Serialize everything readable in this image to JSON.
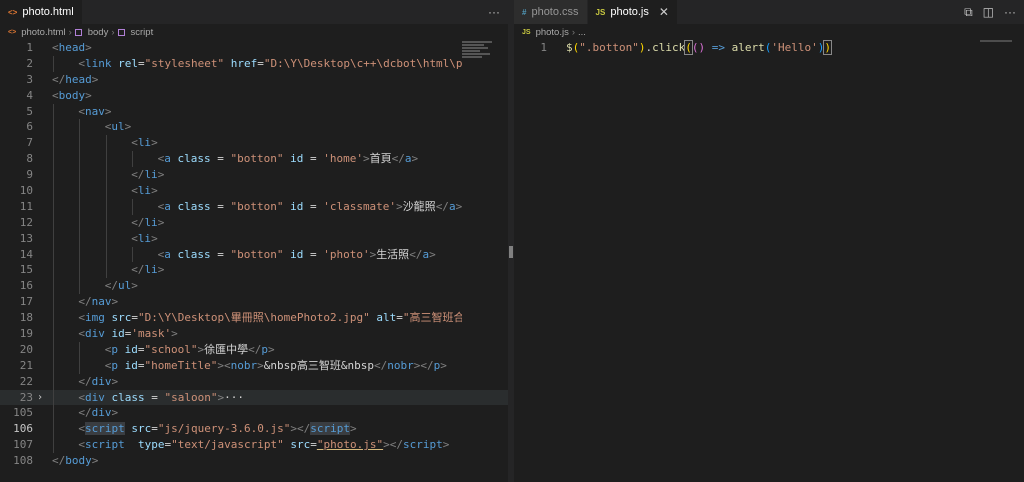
{
  "left": {
    "tab": {
      "label": "photo.html",
      "icon": "html-icon",
      "more": "···"
    },
    "breadcrumb": [
      "photo.html",
      "body",
      "script"
    ],
    "lines": [
      {
        "n": "1",
        "indent": 0,
        "tokens": [
          [
            "br",
            "<"
          ],
          [
            "tag",
            "head"
          ],
          [
            "br",
            ">"
          ]
        ]
      },
      {
        "n": "2",
        "indent": 1,
        "tokens": [
          [
            "br",
            "<"
          ],
          [
            "tag",
            "link"
          ],
          [
            "txt",
            " "
          ],
          [
            "attr",
            "rel"
          ],
          [
            "txt",
            "="
          ],
          [
            "str",
            "\"stylesheet\""
          ],
          [
            "txt",
            " "
          ],
          [
            "attr",
            "href"
          ],
          [
            "txt",
            "="
          ],
          [
            "str",
            "\"D:\\Y\\Desktop\\c++\\dcbot\\html\\ph"
          ]
        ]
      },
      {
        "n": "3",
        "indent": 0,
        "tokens": [
          [
            "br",
            "</"
          ],
          [
            "tag",
            "head"
          ],
          [
            "br",
            ">"
          ]
        ]
      },
      {
        "n": "4",
        "indent": 0,
        "tokens": [
          [
            "br",
            "<"
          ],
          [
            "tag",
            "body"
          ],
          [
            "br",
            ">"
          ]
        ]
      },
      {
        "n": "5",
        "indent": 1,
        "tokens": [
          [
            "br",
            "<"
          ],
          [
            "tag",
            "nav"
          ],
          [
            "br",
            ">"
          ]
        ]
      },
      {
        "n": "6",
        "indent": 2,
        "tokens": [
          [
            "br",
            "<"
          ],
          [
            "tag",
            "ul"
          ],
          [
            "br",
            ">"
          ]
        ]
      },
      {
        "n": "7",
        "indent": 3,
        "tokens": [
          [
            "br",
            "<"
          ],
          [
            "tag",
            "li"
          ],
          [
            "br",
            ">"
          ]
        ]
      },
      {
        "n": "8",
        "indent": 4,
        "tokens": [
          [
            "br",
            "<"
          ],
          [
            "tag",
            "a"
          ],
          [
            "txt",
            " "
          ],
          [
            "attr",
            "class"
          ],
          [
            "txt",
            " = "
          ],
          [
            "str",
            "\"botton\""
          ],
          [
            "txt",
            " "
          ],
          [
            "attr",
            "id"
          ],
          [
            "txt",
            " = "
          ],
          [
            "str",
            "'home'"
          ],
          [
            "br",
            ">"
          ],
          [
            "txt",
            "首頁"
          ],
          [
            "br",
            "</"
          ],
          [
            "tag",
            "a"
          ],
          [
            "br",
            ">"
          ]
        ]
      },
      {
        "n": "9",
        "indent": 3,
        "tokens": [
          [
            "br",
            "</"
          ],
          [
            "tag",
            "li"
          ],
          [
            "br",
            ">"
          ]
        ]
      },
      {
        "n": "10",
        "indent": 3,
        "tokens": [
          [
            "br",
            "<"
          ],
          [
            "tag",
            "li"
          ],
          [
            "br",
            ">"
          ]
        ]
      },
      {
        "n": "11",
        "indent": 4,
        "tokens": [
          [
            "br",
            "<"
          ],
          [
            "tag",
            "a"
          ],
          [
            "txt",
            " "
          ],
          [
            "attr",
            "class"
          ],
          [
            "txt",
            " = "
          ],
          [
            "str",
            "\"botton\""
          ],
          [
            "txt",
            " "
          ],
          [
            "attr",
            "id"
          ],
          [
            "txt",
            " = "
          ],
          [
            "str",
            "'classmate'"
          ],
          [
            "br",
            ">"
          ],
          [
            "txt",
            "沙龍照"
          ],
          [
            "br",
            "</"
          ],
          [
            "tag",
            "a"
          ],
          [
            "br",
            ">"
          ]
        ]
      },
      {
        "n": "12",
        "indent": 3,
        "tokens": [
          [
            "br",
            "</"
          ],
          [
            "tag",
            "li"
          ],
          [
            "br",
            ">"
          ]
        ]
      },
      {
        "n": "13",
        "indent": 3,
        "tokens": [
          [
            "br",
            "<"
          ],
          [
            "tag",
            "li"
          ],
          [
            "br",
            ">"
          ]
        ]
      },
      {
        "n": "14",
        "indent": 4,
        "tokens": [
          [
            "br",
            "<"
          ],
          [
            "tag",
            "a"
          ],
          [
            "txt",
            " "
          ],
          [
            "attr",
            "class"
          ],
          [
            "txt",
            " = "
          ],
          [
            "str",
            "\"botton\""
          ],
          [
            "txt",
            " "
          ],
          [
            "attr",
            "id"
          ],
          [
            "txt",
            " = "
          ],
          [
            "str",
            "'photo'"
          ],
          [
            "br",
            ">"
          ],
          [
            "txt",
            "生活照"
          ],
          [
            "br",
            "</"
          ],
          [
            "tag",
            "a"
          ],
          [
            "br",
            ">"
          ]
        ]
      },
      {
        "n": "15",
        "indent": 3,
        "tokens": [
          [
            "br",
            "</"
          ],
          [
            "tag",
            "li"
          ],
          [
            "br",
            ">"
          ]
        ]
      },
      {
        "n": "16",
        "indent": 2,
        "tokens": [
          [
            "br",
            "</"
          ],
          [
            "tag",
            "ul"
          ],
          [
            "br",
            ">"
          ]
        ]
      },
      {
        "n": "17",
        "indent": 1,
        "tokens": [
          [
            "br",
            "</"
          ],
          [
            "tag",
            "nav"
          ],
          [
            "br",
            ">"
          ]
        ]
      },
      {
        "n": "18",
        "indent": 1,
        "tokens": [
          [
            "br",
            "<"
          ],
          [
            "tag",
            "img"
          ],
          [
            "txt",
            " "
          ],
          [
            "attr",
            "src"
          ],
          [
            "txt",
            "="
          ],
          [
            "str",
            "\"D:\\Y\\Desktop\\畢冊照\\homePhoto2.jpg\""
          ],
          [
            "txt",
            " "
          ],
          [
            "attr",
            "alt"
          ],
          [
            "txt",
            "="
          ],
          [
            "str",
            "\"高三智班合"
          ]
        ]
      },
      {
        "n": "19",
        "indent": 1,
        "tokens": [
          [
            "br",
            "<"
          ],
          [
            "tag",
            "div"
          ],
          [
            "txt",
            " "
          ],
          [
            "attr",
            "id"
          ],
          [
            "txt",
            "="
          ],
          [
            "str",
            "'mask'"
          ],
          [
            "br",
            ">"
          ]
        ]
      },
      {
        "n": "20",
        "indent": 2,
        "tokens": [
          [
            "br",
            "<"
          ],
          [
            "tag",
            "p"
          ],
          [
            "txt",
            " "
          ],
          [
            "attr",
            "id"
          ],
          [
            "txt",
            "="
          ],
          [
            "str",
            "\"school\""
          ],
          [
            "br",
            ">"
          ],
          [
            "txt",
            "徐匯中學"
          ],
          [
            "br",
            "</"
          ],
          [
            "tag",
            "p"
          ],
          [
            "br",
            ">"
          ]
        ]
      },
      {
        "n": "21",
        "indent": 2,
        "tokens": [
          [
            "br",
            "<"
          ],
          [
            "tag",
            "p"
          ],
          [
            "txt",
            " "
          ],
          [
            "attr",
            "id"
          ],
          [
            "txt",
            "="
          ],
          [
            "str",
            "\"homeTitle\""
          ],
          [
            "br",
            ">"
          ],
          [
            "br",
            "<"
          ],
          [
            "tag",
            "nobr"
          ],
          [
            "br",
            ">"
          ],
          [
            "txt",
            "&nbsp高三智班&nbsp"
          ],
          [
            "br",
            "</"
          ],
          [
            "tag",
            "nobr"
          ],
          [
            "br",
            "></"
          ],
          [
            "tag",
            "p"
          ],
          [
            "br",
            ">"
          ]
        ]
      },
      {
        "n": "22",
        "indent": 1,
        "tokens": [
          [
            "br",
            "</"
          ],
          [
            "tag",
            "div"
          ],
          [
            "br",
            ">"
          ]
        ]
      },
      {
        "n": "23",
        "indent": 1,
        "fold": "›",
        "current": true,
        "tokens": [
          [
            "br",
            "<"
          ],
          [
            "tag",
            "div"
          ],
          [
            "txt",
            " "
          ],
          [
            "attr",
            "class"
          ],
          [
            "txt",
            " = "
          ],
          [
            "str",
            "\"saloon\""
          ],
          [
            "br",
            ">"
          ],
          [
            "txt",
            "···"
          ]
        ]
      },
      {
        "n": "105",
        "indent": 1,
        "tokens": [
          [
            "br",
            "</"
          ],
          [
            "tag",
            "div"
          ],
          [
            "br",
            ">"
          ]
        ]
      },
      {
        "n": "106",
        "indent": 1,
        "active": true,
        "tokens": [
          [
            "br",
            "<"
          ],
          [
            "taghl",
            "script"
          ],
          [
            "txt",
            " "
          ],
          [
            "attr",
            "src"
          ],
          [
            "txt",
            "="
          ],
          [
            "str",
            "\"js/jquery-3.6.0.js\""
          ],
          [
            "br",
            "></"
          ],
          [
            "taghl",
            "script"
          ],
          [
            "br",
            ">"
          ]
        ]
      },
      {
        "n": "107",
        "indent": 1,
        "tokens": [
          [
            "br",
            "<"
          ],
          [
            "tag",
            "script"
          ],
          [
            "txt",
            "  "
          ],
          [
            "attr",
            "type"
          ],
          [
            "txt",
            "="
          ],
          [
            "str",
            "\"text/javascript\""
          ],
          [
            "txt",
            " "
          ],
          [
            "attr",
            "src"
          ],
          [
            "txt",
            "="
          ],
          [
            "strul",
            "\"photo.js\""
          ],
          [
            "br",
            "></"
          ],
          [
            "tag",
            "script"
          ],
          [
            "br",
            ">"
          ]
        ]
      },
      {
        "n": "108",
        "indent": 0,
        "tokens": [
          [
            "br",
            "</"
          ],
          [
            "tag",
            "body"
          ],
          [
            "br",
            ">"
          ]
        ]
      }
    ]
  },
  "right": {
    "tabs": [
      {
        "label": "photo.css",
        "icon": "css-icon",
        "active": false
      },
      {
        "label": "photo.js",
        "icon": "js-icon",
        "active": true,
        "close": "✕"
      }
    ],
    "actions": [
      "⧉",
      "◫",
      "···"
    ],
    "breadcrumb": [
      "photo.js",
      "..."
    ],
    "lines": [
      {
        "n": "1",
        "tokens": [
          [
            "fn",
            "$"
          ],
          [
            "yel",
            "("
          ],
          [
            "str",
            "\".botton\""
          ],
          [
            "yel",
            ")"
          ],
          [
            "txt",
            "."
          ],
          [
            "fn",
            "click"
          ],
          [
            "yelbox",
            "("
          ],
          [
            "pur",
            "()"
          ],
          [
            "txt",
            " "
          ],
          [
            "op",
            "=>"
          ],
          [
            "txt",
            " "
          ],
          [
            "fn",
            "alert"
          ],
          [
            "blu",
            "("
          ],
          [
            "str",
            "'Hello'"
          ],
          [
            "blu",
            ")"
          ],
          [
            "yelbox",
            ")"
          ]
        ]
      }
    ]
  },
  "colors": {
    "background": "#1e1e1e",
    "tag": "#569cd6",
    "attr": "#9cdcfe",
    "string": "#ce9178",
    "function": "#dcdcaa"
  }
}
